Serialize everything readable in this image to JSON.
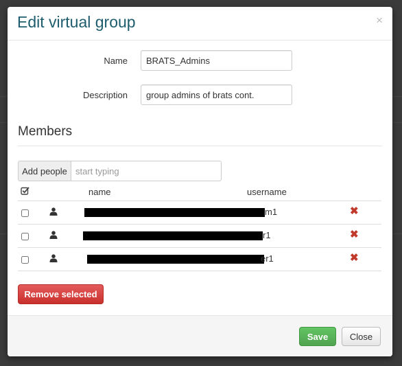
{
  "modal": {
    "title": "Edit virtual group",
    "close_glyph": "×"
  },
  "form": {
    "name_label": "Name",
    "name_value": "BRATS_Admins",
    "description_label": "Description",
    "description_value": "group admins of brats cont."
  },
  "members": {
    "heading": "Members",
    "add_people_label": "Add people",
    "search_placeholder": "start typing",
    "columns": {
      "select_icon": "checkbox-icon",
      "name": "name",
      "username": "username"
    },
    "rows": [
      {
        "name": "",
        "username_suffix": "m1",
        "icon": "user-icon",
        "selected": false
      },
      {
        "name": "",
        "username_suffix": "r1",
        "icon": "user-icon",
        "selected": false
      },
      {
        "name": "",
        "username_suffix": "er1",
        "icon": "user-icon",
        "selected": false
      }
    ],
    "remove_glyph": "✖",
    "remove_selected_label": "Remove selected"
  },
  "footer": {
    "save_label": "Save",
    "close_label": "Close"
  },
  "colors": {
    "title": "#1d5d6e",
    "danger": "#d9534f",
    "success": "#5cb85c",
    "remove_icon": "#c0392b"
  }
}
